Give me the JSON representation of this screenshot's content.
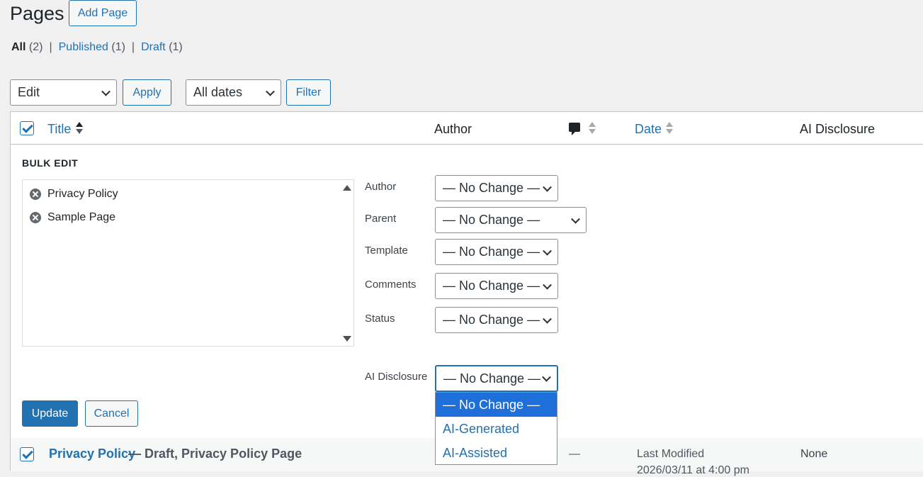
{
  "header": {
    "title": "Pages",
    "add_button": "Add Page"
  },
  "views": [
    {
      "label": "All",
      "count": "(2)",
      "current": true
    },
    {
      "label": "Published",
      "count": "(1)"
    },
    {
      "label": "Draft",
      "count": "(1)"
    }
  ],
  "toolbar": {
    "bulk_action": "Edit",
    "apply": "Apply",
    "dates": "All dates",
    "filter": "Filter"
  },
  "columns": {
    "title": "Title",
    "author": "Author",
    "date": "Date",
    "ai_disclosure": "AI Disclosure"
  },
  "bulk_edit": {
    "heading": "BULK EDIT",
    "titles": [
      "Privacy Policy",
      "Sample Page"
    ],
    "labels": {
      "author": "Author",
      "parent": "Parent",
      "template": "Template",
      "comments": "Comments",
      "status": "Status",
      "ai_disclosure": "AI Disclosure"
    },
    "values": {
      "author": "— No Change —",
      "parent": "— No Change —",
      "template": "— No Change —",
      "comments": "— No Change —",
      "status": "— No Change —",
      "ai_disclosure": "— No Change —"
    },
    "ai_options": [
      "— No Change —",
      "AI-Generated",
      "AI-Assisted"
    ],
    "update": "Update",
    "cancel": "Cancel"
  },
  "row": {
    "title": "Privacy Policy",
    "state": "— Draft, Privacy Policy Page",
    "comments": "—",
    "date_label": "Last Modified",
    "date_value": "2026/03/11 at 4:00 pm",
    "ai_disclosure": "None"
  },
  "colors": {
    "accent": "#2271b1",
    "selected_option": "#1e6fd9"
  }
}
